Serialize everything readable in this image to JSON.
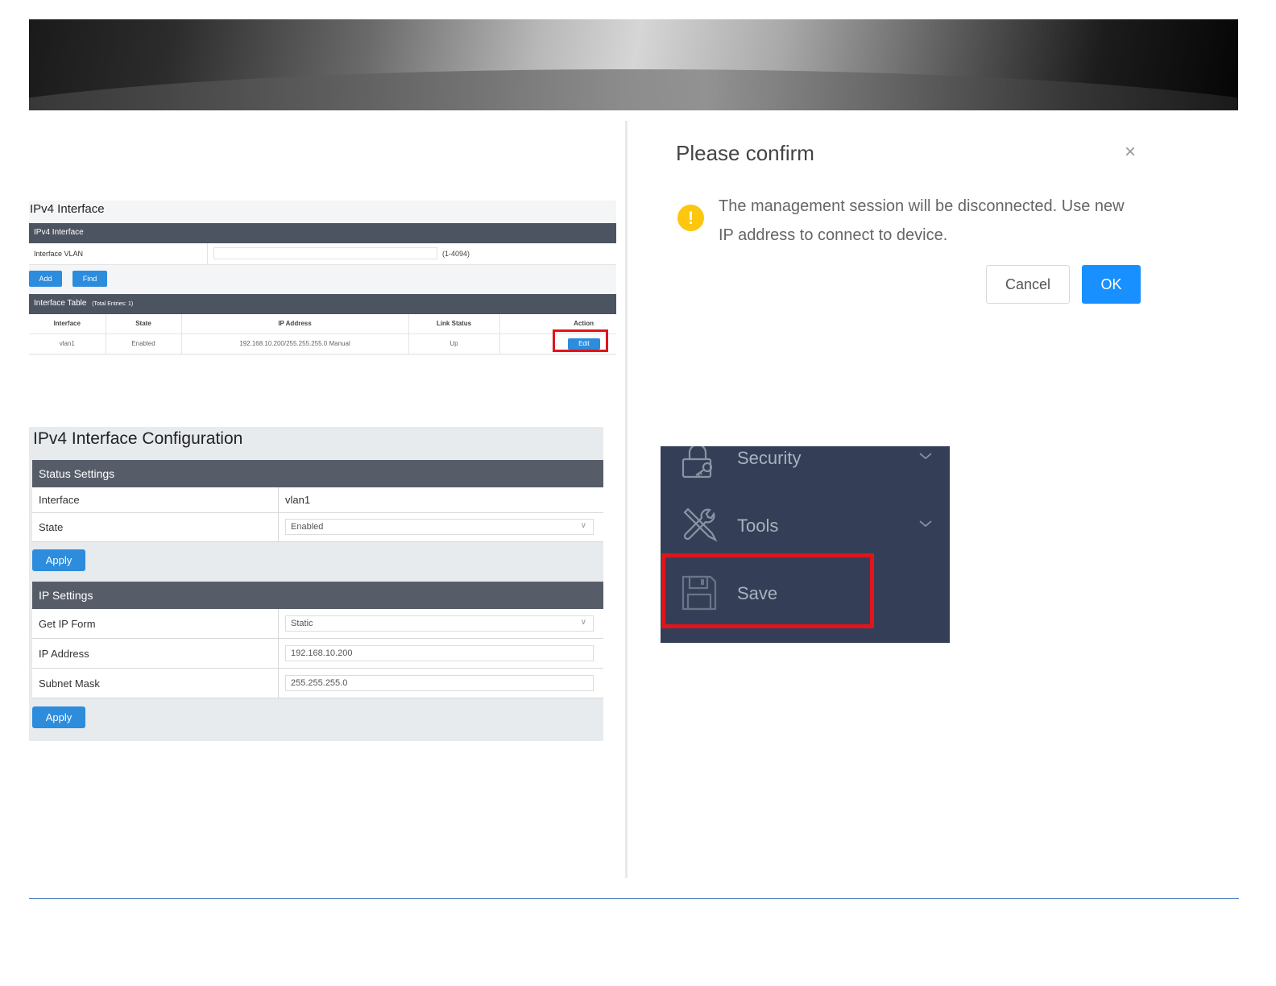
{
  "ipv4_interface": {
    "title": "IPv4 Interface",
    "section_header": "IPv4 Interface",
    "vlan_label": "Interface VLAN",
    "vlan_value": "",
    "vlan_hint": "(1-4094)",
    "add_label": "Add",
    "find_label": "Find",
    "table_header": "Interface Table",
    "table_entries": "(Total Entries: 1)",
    "columns": [
      "Interface",
      "State",
      "IP Address",
      "Link Status",
      "Action"
    ],
    "rows": [
      {
        "interface": "vlan1",
        "state": "Enabled",
        "ip": "192.168.10.200/255.255.255.0 Manual",
        "link": "Up",
        "action": "Edit"
      }
    ]
  },
  "ipv4_config": {
    "title": "IPv4 Interface Configuration",
    "status_header": "Status Settings",
    "interface_label": "Interface",
    "interface_value": "vlan1",
    "state_label": "State",
    "state_value": "Enabled",
    "apply_label": "Apply",
    "ip_header": "IP Settings",
    "get_ip_label": "Get IP Form",
    "get_ip_value": "Static",
    "ip_label": "IP Address",
    "ip_value": "192.168.10.200",
    "mask_label": "Subnet Mask",
    "mask_value": "255.255.255.0",
    "apply2_label": "Apply"
  },
  "dialog": {
    "title": "Please confirm",
    "close_glyph": "×",
    "warn_glyph": "!",
    "message": "The management session will be disconnected. Use new IP address to connect to device.",
    "cancel_label": "Cancel",
    "ok_label": "OK"
  },
  "menu": {
    "items": [
      {
        "label": "Security",
        "icon": "lock-icon"
      },
      {
        "label": "Tools",
        "icon": "tools-icon"
      },
      {
        "label": "Save",
        "icon": "floppy-disk-icon"
      }
    ]
  },
  "colors": {
    "accent": "#2d8cdc",
    "ok_button": "#1890ff",
    "highlight": "#e1141b",
    "menu_bg": "#343f57",
    "header_bar": "#4d5461",
    "warning": "#fdc60f"
  }
}
